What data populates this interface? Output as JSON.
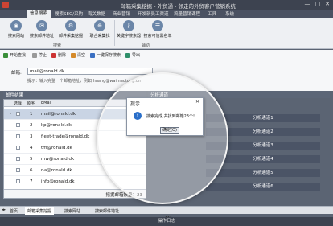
{
  "window": {
    "title": "邮箱采集挖掘 - 外贸通 - 领走的外贸客户营销系统",
    "controls": [
      "—",
      "□",
      "✕"
    ]
  },
  "menu": [
    "信息搜索",
    "搜索SEO/采购",
    "海关数据",
    "商业营销",
    "开发新员工渠道",
    "流量营销课程",
    "工具",
    "系统"
  ],
  "ribbon": {
    "buttons": [
      {
        "label": "搜索网站",
        "icon": "globe-icon"
      },
      {
        "label": "搜索邮件地址",
        "icon": "mail-search-icon"
      },
      {
        "label": "邮件采集挖掘",
        "icon": "mine-icon"
      },
      {
        "label": "联合采集找",
        "icon": "crosshair-icon"
      },
      {
        "label": "关键字搜索器",
        "icon": "key-icon"
      },
      {
        "label": "搜索可信黑名单",
        "icon": "blacklist-icon"
      }
    ],
    "groups": [
      "搜索",
      "辅助"
    ]
  },
  "toolbar": [
    "开始查找",
    "停止",
    "删除",
    "清空",
    "一键保存搜索",
    "导出"
  ],
  "form": {
    "label": "邮箱:",
    "value": "mail@ronald.dk",
    "hint": "提示：输入完整一个邮箱地址，例如 huang@waimaotong.cn"
  },
  "results": {
    "title": "邮件结果",
    "headers": [
      "选择",
      "顺序",
      "EMail"
    ],
    "rows": [
      {
        "num": "1",
        "email": "mail@ronald.dk"
      },
      {
        "num": "2",
        "email": "kp@ronald.dk"
      },
      {
        "num": "3",
        "email": "fleet-trade@ronald.dk"
      },
      {
        "num": "4",
        "email": "tm@ronald.dk"
      },
      {
        "num": "5",
        "email": "mw@ronald.dk"
      },
      {
        "num": "6",
        "email": "r-a@ronald.dk"
      },
      {
        "num": "7",
        "email": "info@ronald.dk"
      }
    ],
    "footer": "挖掘邮箱数量：23"
  },
  "channels": {
    "title": "分析通道",
    "items": [
      "分析通道1",
      "分析通道2",
      "分析通道3",
      "分析通道4",
      "分析通道5",
      "分析通道6"
    ]
  },
  "dialog": {
    "title": "提示",
    "close": "✕",
    "icon": "i",
    "message": "搜索完成,共找到邮箱23个!",
    "ok": "确定(O)"
  },
  "bottom_tabs": [
    "首页",
    "邮箱采集挖掘",
    "搜索网站",
    "搜索邮件地址"
  ],
  "status": "操作日志",
  "colors": {
    "title_bg": "#3d4350",
    "ribbon_bg": "#eef0f3",
    "channel_bg": "#4b5466",
    "selected_row": "#c9d4e4",
    "info_icon": "#2a6fc9"
  }
}
